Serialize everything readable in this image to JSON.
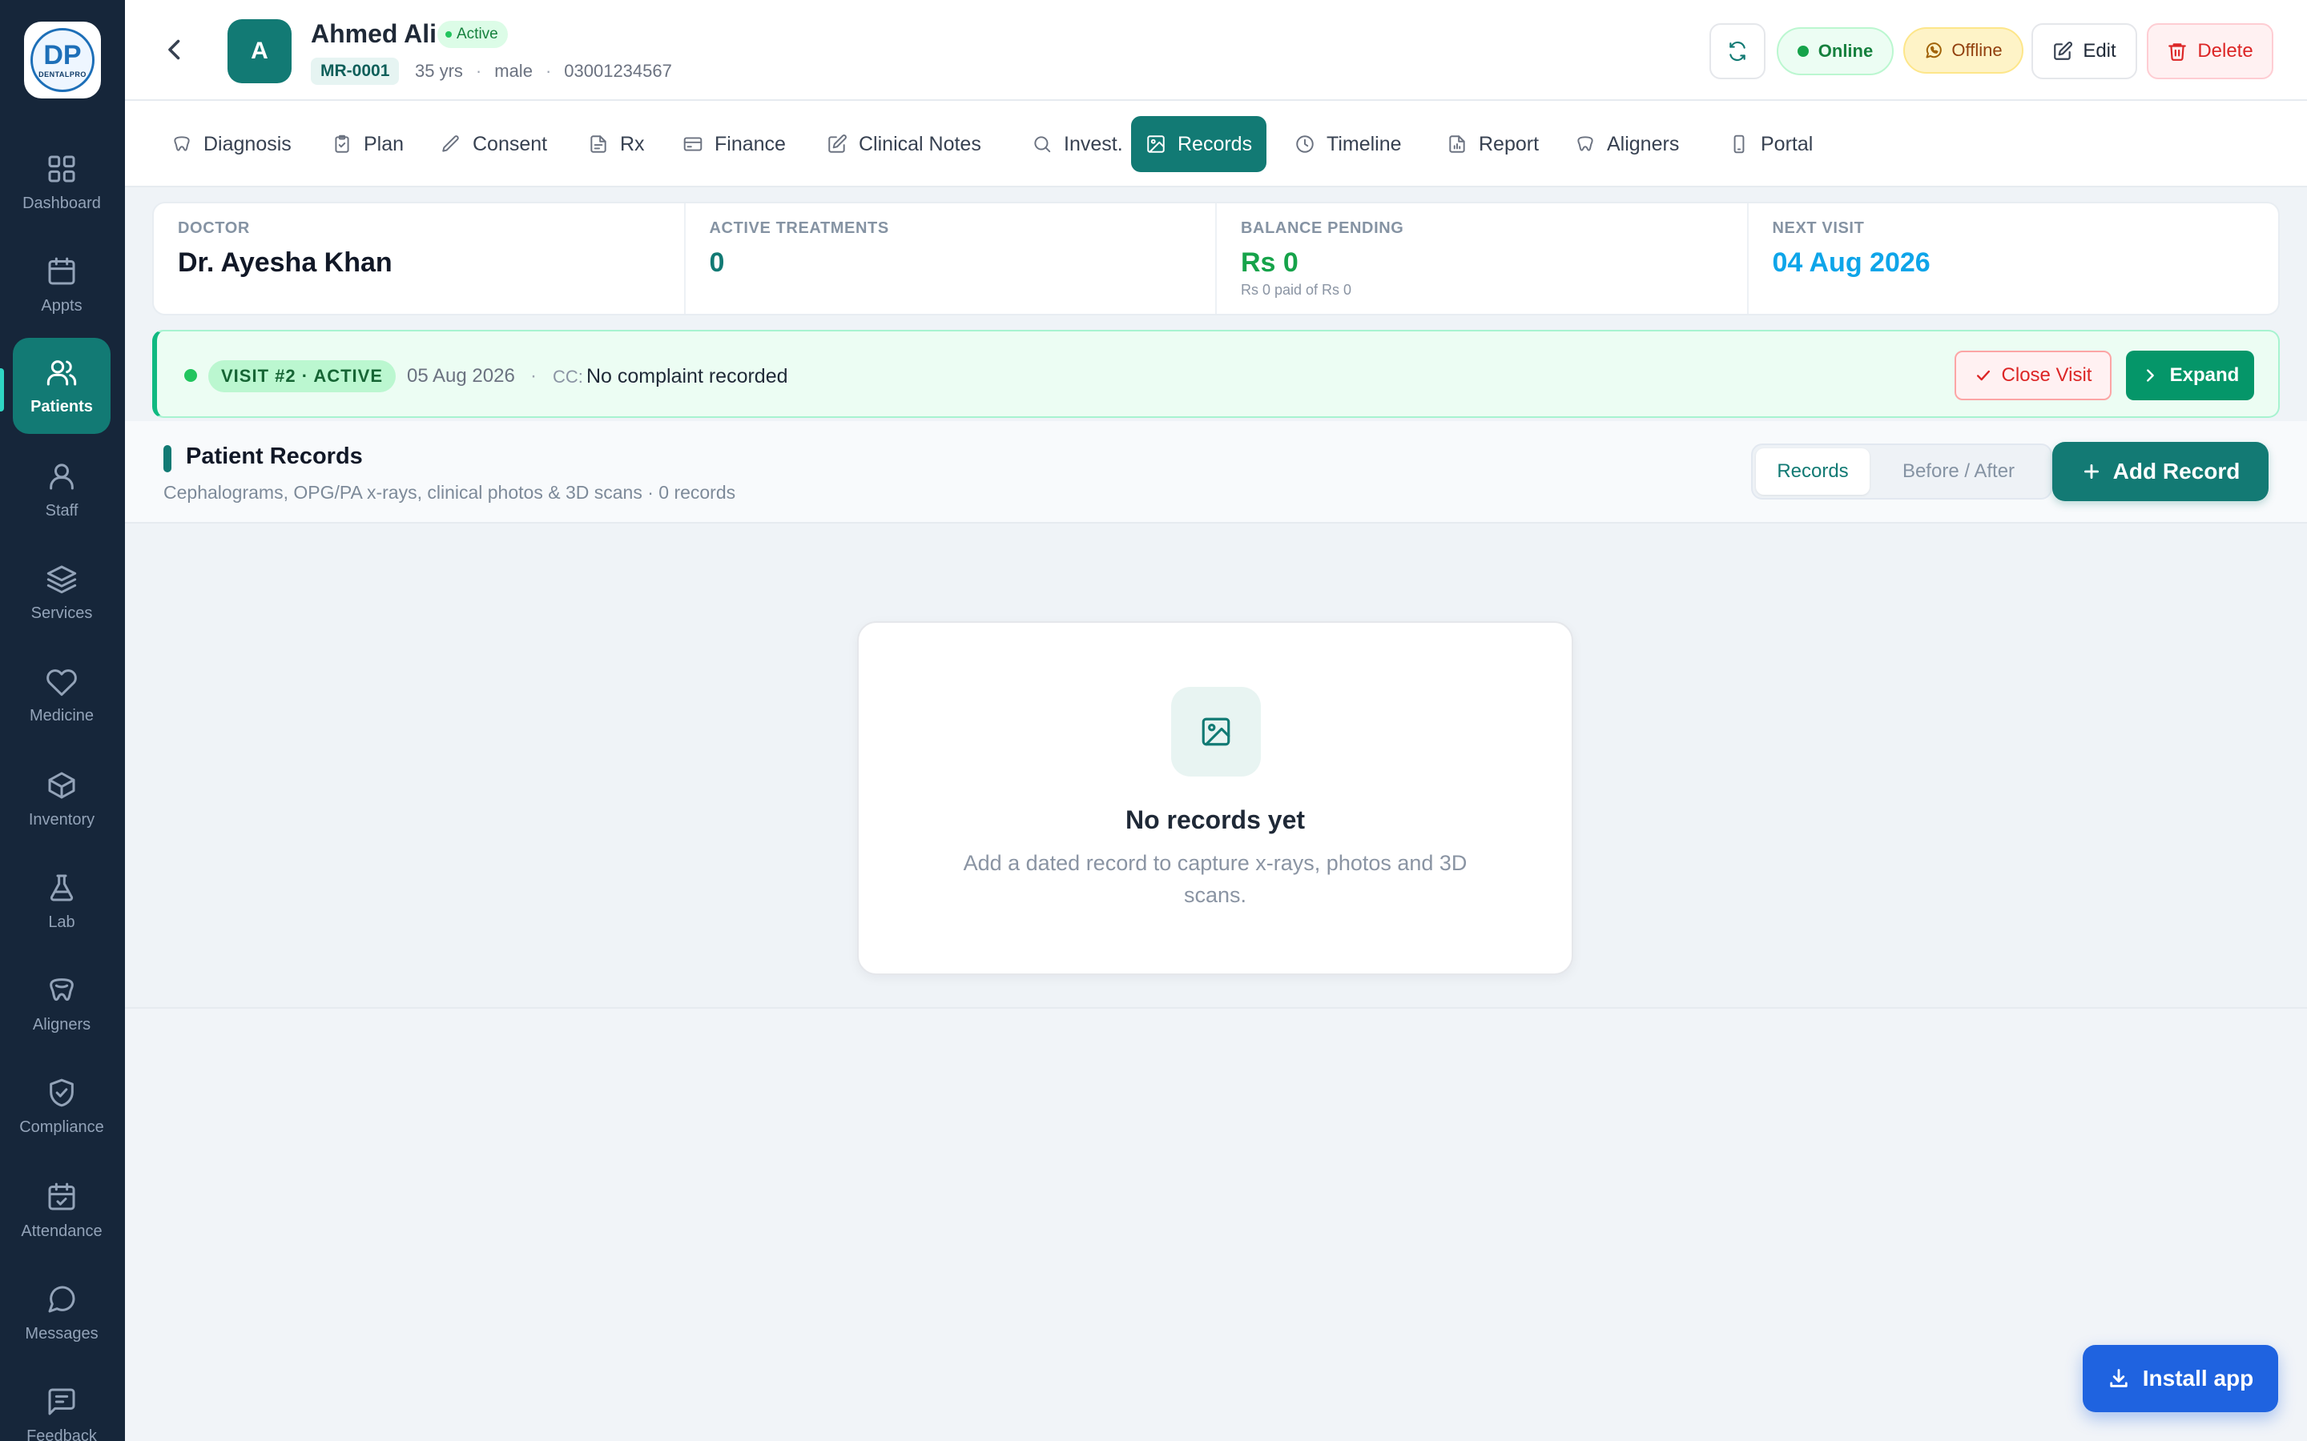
{
  "sidebar": {
    "logo_mark": "DP",
    "logo_text": "DENTALPRO",
    "items": [
      {
        "label": "Dashboard",
        "icon": "grid-icon"
      },
      {
        "label": "Appts",
        "icon": "calendar-icon"
      },
      {
        "label": "Patients",
        "icon": "users-icon",
        "active": true
      },
      {
        "label": "Staff",
        "icon": "user-icon"
      },
      {
        "label": "Services",
        "icon": "layers-icon"
      },
      {
        "label": "Medicine",
        "icon": "heart-icon"
      },
      {
        "label": "Inventory",
        "icon": "box-icon"
      },
      {
        "label": "Lab",
        "icon": "flask-icon"
      },
      {
        "label": "Aligners",
        "icon": "tooth-icon"
      },
      {
        "label": "Compliance",
        "icon": "shield-check-icon"
      },
      {
        "label": "Attendance",
        "icon": "calendar-check-icon"
      },
      {
        "label": "Messages",
        "icon": "message-circle-icon"
      },
      {
        "label": "Feedback",
        "icon": "message-square-icon"
      }
    ]
  },
  "header": {
    "avatar_initial": "A",
    "patient_name": "Ahmed Ali",
    "status": "Active",
    "mr_number": "MR-0001",
    "age": "35 yrs",
    "gender": "male",
    "phone": "03001234567",
    "meta_sep": "·",
    "online_label": "Online",
    "offline_label": "Offline",
    "edit_label": "Edit",
    "delete_label": "Delete"
  },
  "tabs": [
    {
      "label": "Diagnosis",
      "icon": "tooth-icon"
    },
    {
      "label": "Plan",
      "icon": "clipboard-icon"
    },
    {
      "label": "Consent",
      "icon": "pen-icon"
    },
    {
      "label": "Rx",
      "icon": "file-icon"
    },
    {
      "label": "Finance",
      "icon": "credit-card-icon"
    },
    {
      "label": "Clinical Notes",
      "icon": "edit-icon"
    },
    {
      "label": "Invest.",
      "icon": "search-icon"
    },
    {
      "label": "Records",
      "icon": "image-icon",
      "active": true
    },
    {
      "label": "Timeline",
      "icon": "clock-icon"
    },
    {
      "label": "Report",
      "icon": "file-text-icon"
    },
    {
      "label": "Aligners",
      "icon": "tooth-icon"
    },
    {
      "label": "Portal",
      "icon": "smartphone-icon"
    }
  ],
  "stats": {
    "doctor_label": "DOCTOR",
    "doctor_value": "Dr. Ayesha Khan",
    "active_treatments_label": "ACTIVE TREATMENTS",
    "active_treatments_value": "0",
    "balance_label": "BALANCE PENDING",
    "balance_value": "Rs 0",
    "balance_sub": "Rs 0 paid of Rs 0",
    "next_visit_label": "NEXT VISIT",
    "next_visit_value": "04 Aug 2026"
  },
  "visit": {
    "badge": "VISIT #2 · ACTIVE",
    "date": "05 Aug 2026",
    "sep": "·",
    "cc_label": "CC:",
    "cc_value": "No complaint recorded",
    "close_label": "Close Visit",
    "expand_label": "Expand"
  },
  "records": {
    "title": "Patient Records",
    "subtitle": "Cephalograms, OPG/PA x-rays, clinical photos & 3D scans · 0 records",
    "toggle_records": "Records",
    "toggle_before_after": "Before / After",
    "add_label": "Add Record",
    "empty_title": "No records yet",
    "empty_text": "Add a dated record to capture x-rays, photos and 3D scans."
  },
  "install_label": "Install app",
  "colors": {
    "sidebar_bg": "#16263a",
    "primary_teal": "#127a74",
    "success_green": "#16a34a",
    "danger_red": "#dc2626",
    "install_blue": "#1f63e0"
  }
}
